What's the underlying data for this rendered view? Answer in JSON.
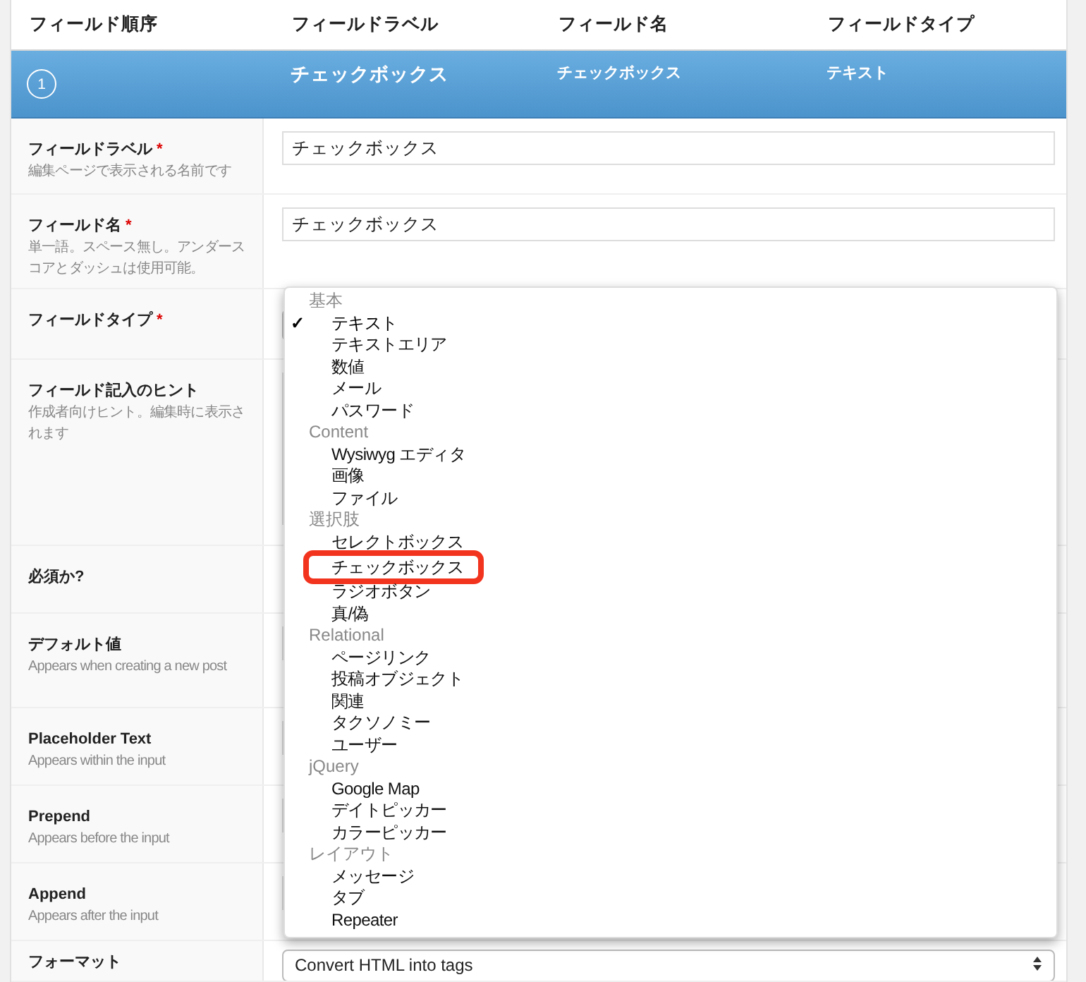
{
  "table": {
    "columns": [
      "フィールド順序",
      "フィールドラベル",
      "フィールド名",
      "フィールドタイプ"
    ]
  },
  "field_row": {
    "number": "1",
    "label": "チェックボックス",
    "name": "チェックボックス",
    "type": "テキスト"
  },
  "settings": [
    {
      "label": "フィールドラベル",
      "required_mark": "*",
      "hint": "編集ページで表示される名前です",
      "kind": "text",
      "value": "チェックボックス"
    },
    {
      "label": "フィールド名",
      "required_mark": "*",
      "hint": "単一語。スペース無し。アンダースコアとダッシュは使用可能。",
      "kind": "text",
      "value": "チェックボックス"
    },
    {
      "label": "フィールドタイプ",
      "required_mark": "*",
      "kind": "select"
    },
    {
      "label": "フィールド記入のヒント",
      "hint": "作成者向けヒント。編集時に表示されます",
      "kind": "textarea"
    },
    {
      "label": "必須か?",
      "kind": "none"
    },
    {
      "label": "デフォルト値",
      "hint": "Appears when creating a new post",
      "kind": "text"
    },
    {
      "label": "Placeholder Text",
      "hint": "Appears within the input",
      "kind": "text"
    },
    {
      "label": "Prepend",
      "hint": "Appears before the input",
      "kind": "text"
    },
    {
      "label": "Append",
      "hint": "Appears after the input",
      "kind": "text"
    },
    {
      "label": "フォーマット",
      "kind": "select",
      "value": "Convert HTML into tags"
    }
  ],
  "dropdown": {
    "check_mark": "✓",
    "groups": [
      {
        "label": "基本",
        "options": [
          {
            "label": "テキスト",
            "selected": true,
            "highlighted": false
          },
          {
            "label": "テキストエリア",
            "selected": false,
            "highlighted": false
          },
          {
            "label": "数値",
            "selected": false,
            "highlighted": false
          },
          {
            "label": "メール",
            "selected": false,
            "highlighted": false
          },
          {
            "label": "パスワード",
            "selected": false,
            "highlighted": false
          }
        ]
      },
      {
        "label": "Content",
        "options": [
          {
            "label": "Wysiwyg エディタ",
            "selected": false,
            "highlighted": false
          },
          {
            "label": "画像",
            "selected": false,
            "highlighted": false
          },
          {
            "label": "ファイル",
            "selected": false,
            "highlighted": false
          }
        ]
      },
      {
        "label": "選択肢",
        "options": [
          {
            "label": "セレクトボックス",
            "selected": false,
            "highlighted": false
          },
          {
            "label": "チェックボックス",
            "selected": false,
            "highlighted": true
          },
          {
            "label": "ラジオボタン",
            "selected": false,
            "highlighted": false
          },
          {
            "label": "真/偽",
            "selected": false,
            "highlighted": false
          }
        ]
      },
      {
        "label": "Relational",
        "options": [
          {
            "label": "ページリンク",
            "selected": false,
            "highlighted": false
          },
          {
            "label": "投稿オブジェクト",
            "selected": false,
            "highlighted": false
          },
          {
            "label": "関連",
            "selected": false,
            "highlighted": false
          },
          {
            "label": "タクソノミー",
            "selected": false,
            "highlighted": false
          },
          {
            "label": "ユーザー",
            "selected": false,
            "highlighted": false
          }
        ]
      },
      {
        "label": "jQuery",
        "options": [
          {
            "label": "Google Map",
            "selected": false,
            "highlighted": false
          },
          {
            "label": "デイトピッカー",
            "selected": false,
            "highlighted": false
          },
          {
            "label": "カラーピッカー",
            "selected": false,
            "highlighted": false
          }
        ]
      },
      {
        "label": "レイアウト",
        "options": [
          {
            "label": "メッセージ",
            "selected": false,
            "highlighted": false
          },
          {
            "label": "タブ",
            "selected": false,
            "highlighted": false
          },
          {
            "label": "Repeater",
            "selected": false,
            "highlighted": false
          }
        ]
      }
    ]
  }
}
